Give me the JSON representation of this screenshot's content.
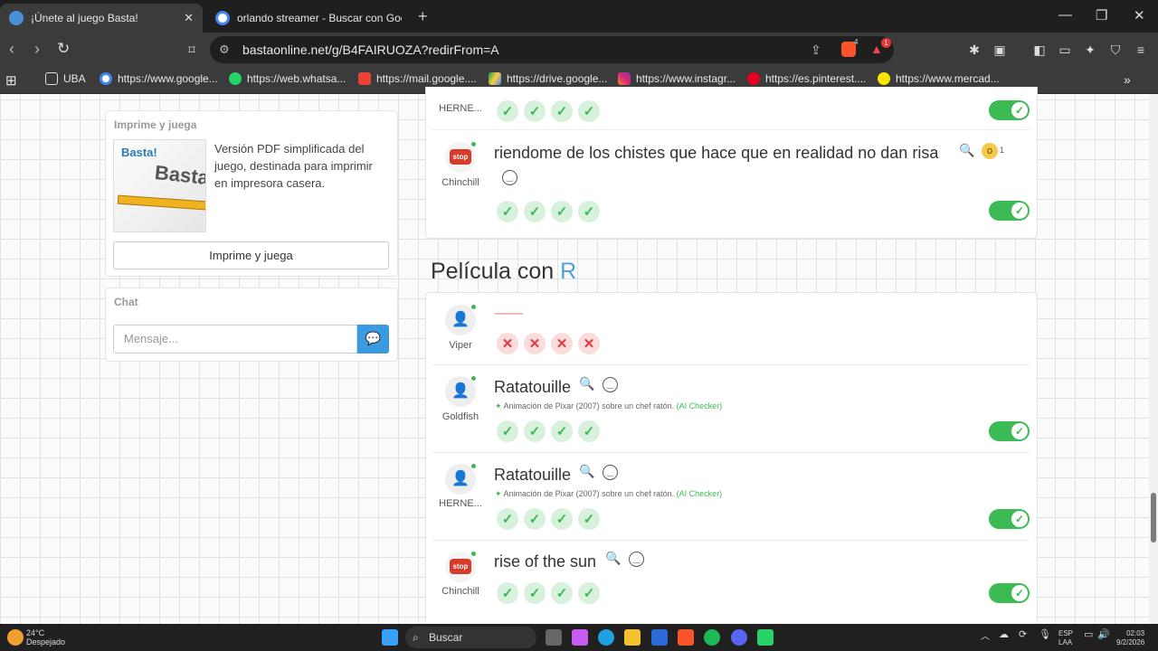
{
  "browser": {
    "tabs": [
      {
        "title": "¡Únete al juego Basta!",
        "active": true,
        "fav_color": "#4a90d9"
      },
      {
        "title": "orlando streamer - Buscar con Googl",
        "active": false,
        "fav_color": "#ffffff"
      }
    ],
    "url": "bastaonline.net/g/B4FAIRUOZA?redirFrom=A",
    "shield_count": "4",
    "alert_count": "1",
    "bookmarks": [
      {
        "label": "UBA",
        "icon": "folder-icon"
      },
      {
        "label": "https://www.google...",
        "icon": "google-icon"
      },
      {
        "label": "https://web.whatsa...",
        "icon": "whatsapp-icon"
      },
      {
        "label": "https://mail.google....",
        "icon": "gmail-icon"
      },
      {
        "label": "https://drive.google...",
        "icon": "drive-icon"
      },
      {
        "label": "https://www.instagr...",
        "icon": "instagram-icon"
      },
      {
        "label": "https://es.pinterest....",
        "icon": "pinterest-icon"
      },
      {
        "label": "https://www.mercad...",
        "icon": "mercadolibre-icon"
      }
    ]
  },
  "sidebar": {
    "print_card": {
      "title": "Imprime y juega",
      "description": "Versión PDF simplificada del juego, destinada para imprimir en impresora casera.",
      "button": "Imprime y juega",
      "image_logo": "Basta!",
      "image_text": "Basta"
    },
    "chat": {
      "title": "Chat",
      "placeholder": "Mensaje..."
    }
  },
  "game": {
    "prev_category": {
      "entries": [
        {
          "user": "HERNE...",
          "answer": "",
          "votes": [
            "ok",
            "ok",
            "ok",
            "ok"
          ],
          "toggle": true
        },
        {
          "user": "Chinchill",
          "answer": "riendome de los chistes que hace que en realidad no dan risa",
          "reaction_count": "1",
          "votes": [
            "ok",
            "ok",
            "ok",
            "ok"
          ],
          "toggle": true
        }
      ]
    },
    "section_prefix": "Película con",
    "section_letter": "R",
    "entries": [
      {
        "user": "Viper",
        "answer": "",
        "votes": [
          "no",
          "no",
          "no",
          "no"
        ]
      },
      {
        "user": "Goldfish",
        "answer": "Ratatouille",
        "hint": "Animación de Pixar (2007) sobre un chef ratón.",
        "hint_source": "(AI Checker)",
        "votes": [
          "ok",
          "ok",
          "ok",
          "ok"
        ],
        "toggle": true
      },
      {
        "user": "HERNE...",
        "answer": "Ratatouille",
        "hint": "Animación de Pixar (2007) sobre un chef ratón.",
        "hint_source": "(AI Checker)",
        "votes": [
          "ok",
          "ok",
          "ok",
          "ok"
        ],
        "toggle": true
      },
      {
        "user": "Chinchill",
        "answer": "rise of the sun",
        "votes": [
          "ok",
          "ok",
          "ok",
          "ok"
        ],
        "toggle": true
      }
    ],
    "stop_label": "stop"
  },
  "taskbar": {
    "weather_temp": "24°C",
    "weather_desc": "Despejado",
    "search": "Buscar",
    "lang": "ESP",
    "lang2": "LAA",
    "time": "02:03",
    "date": "9/2/2026"
  }
}
